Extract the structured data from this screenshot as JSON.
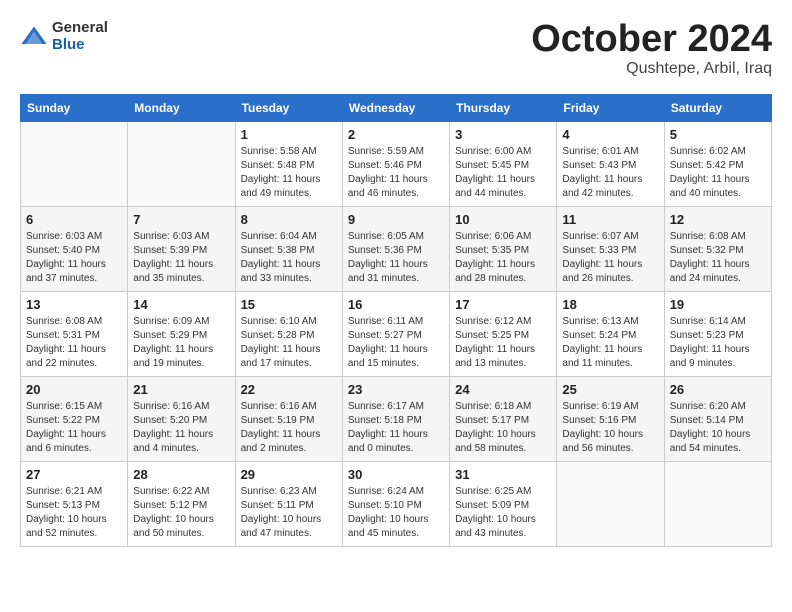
{
  "header": {
    "logo_general": "General",
    "logo_blue": "Blue",
    "month": "October 2024",
    "location": "Qushtepe, Arbil, Iraq"
  },
  "days_of_week": [
    "Sunday",
    "Monday",
    "Tuesday",
    "Wednesday",
    "Thursday",
    "Friday",
    "Saturday"
  ],
  "weeks": [
    [
      {
        "day": "",
        "info": ""
      },
      {
        "day": "",
        "info": ""
      },
      {
        "day": "1",
        "info": "Sunrise: 5:58 AM\nSunset: 5:48 PM\nDaylight: 11 hours and 49 minutes."
      },
      {
        "day": "2",
        "info": "Sunrise: 5:59 AM\nSunset: 5:46 PM\nDaylight: 11 hours and 46 minutes."
      },
      {
        "day": "3",
        "info": "Sunrise: 6:00 AM\nSunset: 5:45 PM\nDaylight: 11 hours and 44 minutes."
      },
      {
        "day": "4",
        "info": "Sunrise: 6:01 AM\nSunset: 5:43 PM\nDaylight: 11 hours and 42 minutes."
      },
      {
        "day": "5",
        "info": "Sunrise: 6:02 AM\nSunset: 5:42 PM\nDaylight: 11 hours and 40 minutes."
      }
    ],
    [
      {
        "day": "6",
        "info": "Sunrise: 6:03 AM\nSunset: 5:40 PM\nDaylight: 11 hours and 37 minutes."
      },
      {
        "day": "7",
        "info": "Sunrise: 6:03 AM\nSunset: 5:39 PM\nDaylight: 11 hours and 35 minutes."
      },
      {
        "day": "8",
        "info": "Sunrise: 6:04 AM\nSunset: 5:38 PM\nDaylight: 11 hours and 33 minutes."
      },
      {
        "day": "9",
        "info": "Sunrise: 6:05 AM\nSunset: 5:36 PM\nDaylight: 11 hours and 31 minutes."
      },
      {
        "day": "10",
        "info": "Sunrise: 6:06 AM\nSunset: 5:35 PM\nDaylight: 11 hours and 28 minutes."
      },
      {
        "day": "11",
        "info": "Sunrise: 6:07 AM\nSunset: 5:33 PM\nDaylight: 11 hours and 26 minutes."
      },
      {
        "day": "12",
        "info": "Sunrise: 6:08 AM\nSunset: 5:32 PM\nDaylight: 11 hours and 24 minutes."
      }
    ],
    [
      {
        "day": "13",
        "info": "Sunrise: 6:08 AM\nSunset: 5:31 PM\nDaylight: 11 hours and 22 minutes."
      },
      {
        "day": "14",
        "info": "Sunrise: 6:09 AM\nSunset: 5:29 PM\nDaylight: 11 hours and 19 minutes."
      },
      {
        "day": "15",
        "info": "Sunrise: 6:10 AM\nSunset: 5:28 PM\nDaylight: 11 hours and 17 minutes."
      },
      {
        "day": "16",
        "info": "Sunrise: 6:11 AM\nSunset: 5:27 PM\nDaylight: 11 hours and 15 minutes."
      },
      {
        "day": "17",
        "info": "Sunrise: 6:12 AM\nSunset: 5:25 PM\nDaylight: 11 hours and 13 minutes."
      },
      {
        "day": "18",
        "info": "Sunrise: 6:13 AM\nSunset: 5:24 PM\nDaylight: 11 hours and 11 minutes."
      },
      {
        "day": "19",
        "info": "Sunrise: 6:14 AM\nSunset: 5:23 PM\nDaylight: 11 hours and 9 minutes."
      }
    ],
    [
      {
        "day": "20",
        "info": "Sunrise: 6:15 AM\nSunset: 5:22 PM\nDaylight: 11 hours and 6 minutes."
      },
      {
        "day": "21",
        "info": "Sunrise: 6:16 AM\nSunset: 5:20 PM\nDaylight: 11 hours and 4 minutes."
      },
      {
        "day": "22",
        "info": "Sunrise: 6:16 AM\nSunset: 5:19 PM\nDaylight: 11 hours and 2 minutes."
      },
      {
        "day": "23",
        "info": "Sunrise: 6:17 AM\nSunset: 5:18 PM\nDaylight: 11 hours and 0 minutes."
      },
      {
        "day": "24",
        "info": "Sunrise: 6:18 AM\nSunset: 5:17 PM\nDaylight: 10 hours and 58 minutes."
      },
      {
        "day": "25",
        "info": "Sunrise: 6:19 AM\nSunset: 5:16 PM\nDaylight: 10 hours and 56 minutes."
      },
      {
        "day": "26",
        "info": "Sunrise: 6:20 AM\nSunset: 5:14 PM\nDaylight: 10 hours and 54 minutes."
      }
    ],
    [
      {
        "day": "27",
        "info": "Sunrise: 6:21 AM\nSunset: 5:13 PM\nDaylight: 10 hours and 52 minutes."
      },
      {
        "day": "28",
        "info": "Sunrise: 6:22 AM\nSunset: 5:12 PM\nDaylight: 10 hours and 50 minutes."
      },
      {
        "day": "29",
        "info": "Sunrise: 6:23 AM\nSunset: 5:11 PM\nDaylight: 10 hours and 47 minutes."
      },
      {
        "day": "30",
        "info": "Sunrise: 6:24 AM\nSunset: 5:10 PM\nDaylight: 10 hours and 45 minutes."
      },
      {
        "day": "31",
        "info": "Sunrise: 6:25 AM\nSunset: 5:09 PM\nDaylight: 10 hours and 43 minutes."
      },
      {
        "day": "",
        "info": ""
      },
      {
        "day": "",
        "info": ""
      }
    ]
  ]
}
